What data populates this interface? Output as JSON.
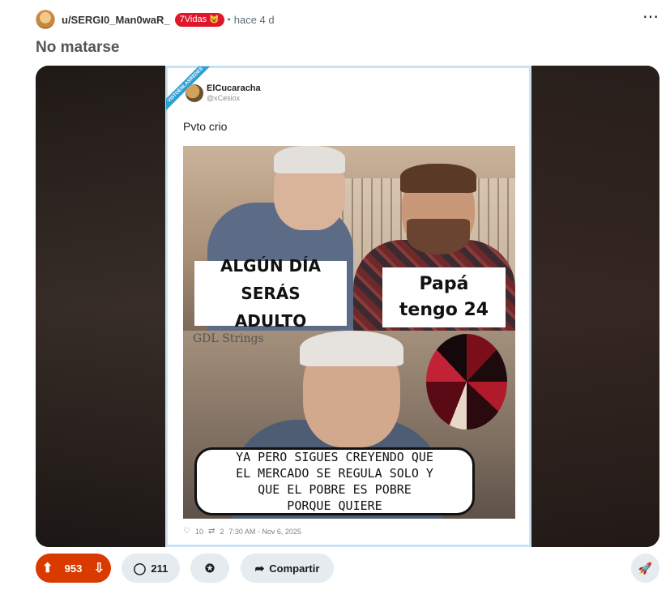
{
  "post": {
    "username": "u/SERGI0_Man0waR_",
    "flair_text": "7Vidas",
    "flair_emoji": "😺",
    "separator": "•",
    "time": "hace 4 d",
    "more_icon": "⋯",
    "title": "No matarse"
  },
  "media": {
    "tweet": {
      "ribbon": "VISTOENLASREDES",
      "author_name": "ElCucaracha",
      "author_handle": "@xCesiox",
      "text": "Pvto crio",
      "meme": {
        "box1_lines": [
          "ALGÚN DÍA SERÁS",
          "ADULTO"
        ],
        "box2_lines": [
          "Papá",
          "tengo 24"
        ],
        "watermark": "GDL Strings",
        "speech_lines": [
          "YA PERO SIGUES CREYENDO QUE",
          "EL MERCADO SE REGULA SOLO Y",
          "QUE EL POBRE ES POBRE",
          "PORQUE QUIERE"
        ]
      },
      "footer": {
        "likes": "10",
        "retweets": "2",
        "timestamp": "7:30 AM - Nov 6, 2025"
      }
    }
  },
  "actions": {
    "score": "953",
    "comments": "211",
    "share_label": "Compartir"
  },
  "colors": {
    "upvote_bg": "#d93a00",
    "flair_bg": "#e0162b",
    "pill_bg": "#e5ebee"
  }
}
